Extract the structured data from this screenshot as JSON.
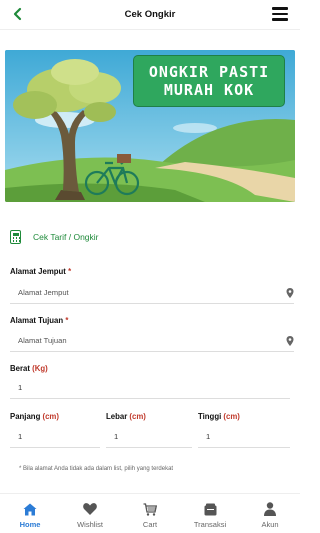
{
  "header": {
    "title": "Cek Ongkir"
  },
  "banner": {
    "line1": "ONGKIR PASTI",
    "line2": "MURAH KOK"
  },
  "section": {
    "label": "Cek Tarif / Ongkir"
  },
  "form": {
    "pickup": {
      "label": "Alamat Jemput",
      "required": "*",
      "placeholder": "Alamat Jemput"
    },
    "destination": {
      "label": "Alamat Tujuan",
      "required": "*",
      "placeholder": "Alamat Tujuan"
    },
    "weight": {
      "label": "Berat",
      "unit": "(Kg)",
      "value": "1"
    },
    "length": {
      "label": "Panjang",
      "unit": "(cm)",
      "value": "1"
    },
    "width": {
      "label": "Lebar",
      "unit": "(cm)",
      "value": "1"
    },
    "height": {
      "label": "Tinggi",
      "unit": "(cm)",
      "value": "1"
    },
    "note": "* Bila alamat Anda tidak ada dalam list, pilih yang terdekat"
  },
  "tabs": [
    {
      "label": "Home",
      "icon": "home-icon",
      "active": true
    },
    {
      "label": "Wishlist",
      "icon": "heart-icon",
      "active": false
    },
    {
      "label": "Cart",
      "icon": "cart-icon",
      "active": false
    },
    {
      "label": "Transaksi",
      "icon": "wallet-icon",
      "active": false
    },
    {
      "label": "Akun",
      "icon": "user-icon",
      "active": false
    }
  ],
  "colors": {
    "primary": "#1f8a3a",
    "active_tab": "#2c7cd6",
    "required": "#c0392b",
    "promo_bg": "#2fa75e"
  }
}
